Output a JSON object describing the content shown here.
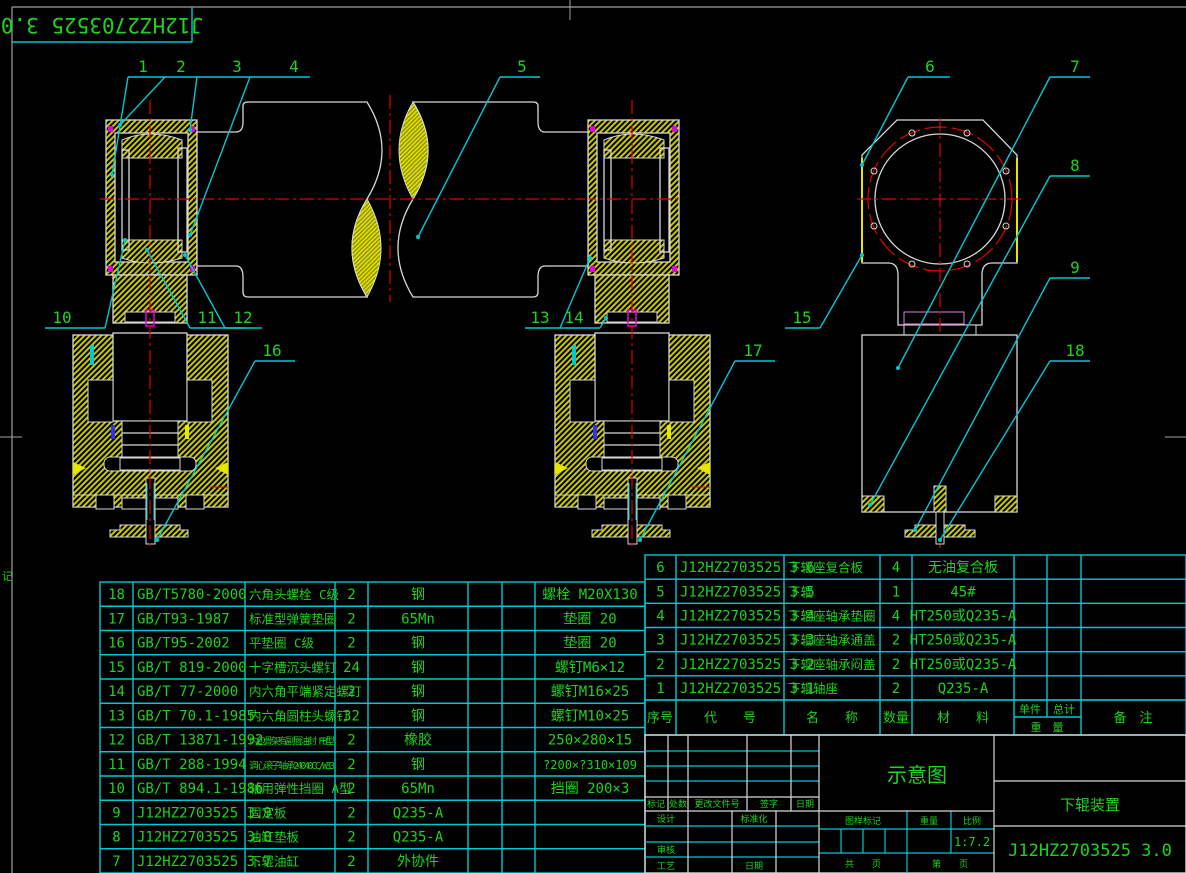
{
  "drawing_number_rotated": "J12HZ2703525 3.0",
  "side_mark": "记",
  "drawing": {
    "balloons": [
      "1",
      "2",
      "3",
      "4",
      "5",
      "6",
      "7",
      "8",
      "9",
      "10",
      "11",
      "12",
      "13",
      "14",
      "15",
      "16",
      "17",
      "18"
    ]
  },
  "parts_list_lower": [
    [
      "18",
      "GB/T5780-2000",
      "六角头螺栓 C级",
      "2",
      "钢",
      "",
      "",
      "螺栓 M20X130"
    ],
    [
      "17",
      "GB/T93-1987",
      "标准型弹簧垫圈",
      "2",
      "65Mn",
      "",
      "",
      "垫圈 20"
    ],
    [
      "16",
      "GB/T95-2002",
      "平垫圈 C级",
      "2",
      "钢",
      "",
      "",
      "垫圈 20"
    ],
    [
      "15",
      "GB/T 819-2000",
      "十字槽沉头螺钉",
      "24",
      "钢",
      "",
      "",
      "螺钉M6×12"
    ],
    [
      "14",
      "GB/T 77-2000",
      "内六角平端紧定螺钉",
      "2",
      "钢",
      "",
      "",
      "螺钉M16×25"
    ],
    [
      "13",
      "GB/T 70.1-1985",
      "内六角圆柱头螺钉",
      "32",
      "钢",
      "",
      "",
      "螺钉M10×25"
    ],
    [
      "12",
      "GB/T 13871-1992",
      "内包骨架有副唇油封 FB型",
      "2",
      "橡胶",
      "",
      "",
      "250×280×15"
    ],
    [
      "11",
      "GB/T 288-1994",
      "调心滚子轴承24040CC/W33",
      "2",
      "钢",
      "",
      "",
      "?200×?310×109"
    ],
    [
      "10",
      "GB/T 894.1-1986",
      "轴用弹性挡圈 A型",
      "2",
      "65Mn",
      "",
      "",
      "挡圈 200×3"
    ],
    [
      "9",
      "J12HZ2703525 3.9",
      "固定板",
      "2",
      "Q235-A",
      "",
      "",
      ""
    ],
    [
      "8",
      "J12HZ2703525 3.8",
      "油缸垫板",
      "2",
      "Q235-A",
      "",
      "",
      ""
    ],
    [
      "7",
      "J12HZ2703525 3.7",
      "下辊油缸",
      "2",
      "外协件",
      "",
      "",
      ""
    ]
  ],
  "parts_list_upper": [
    [
      "6",
      "J12HZ2703525 3.6",
      "下辊座复合板",
      "4",
      "无油复合板",
      "",
      "",
      ""
    ],
    [
      "5",
      "J12HZ2703525 3.5",
      "下辊",
      "1",
      "45#",
      "",
      "",
      ""
    ],
    [
      "4",
      "J12HZ2703525 3.4",
      "下辊座轴承垫圈",
      "4",
      "HT250或Q235-A",
      "",
      "",
      ""
    ],
    [
      "3",
      "J12HZ2703525 3.3",
      "下辊座轴承通盖",
      "2",
      "HT250或Q235-A",
      "",
      "",
      ""
    ],
    [
      "2",
      "J12HZ2703525 3.2",
      "下辊座轴承闷盖",
      "2",
      "HT250或Q235-A",
      "",
      "",
      ""
    ],
    [
      "1",
      "J12HZ2703525 3.1",
      "下辊轴座",
      "2",
      "Q235-A",
      "",
      "",
      ""
    ]
  ],
  "parts_header": {
    "no": "序号",
    "code": "代　　号",
    "name": "名　　称",
    "qty": "数量",
    "material": "材　　料",
    "single": "单件",
    "total": "总计",
    "weight": "重　量",
    "note": "备　注"
  },
  "title_block": {
    "mark": "标记",
    "count": "处数",
    "change_doc": "更改文件号",
    "signature": "签字",
    "date": "日期",
    "design": "设计",
    "standardize": "标准化",
    "review": "审核",
    "process": "工艺",
    "date2": "日期",
    "drawing_type": "示意图",
    "stage_mark": "图样标记",
    "weight": "重量",
    "scale": "比例",
    "scale_value": "1:7.2",
    "total_sheets": "共　　页",
    "sheet_no": "第　　页",
    "assembly_name": "下辊装置",
    "drawing_number": "J12HZ2703525 3.0"
  },
  "colors": {
    "text": "#1ed21e",
    "grid": "#00c8d2",
    "line": "#d8d8d8",
    "center": "#e00000",
    "hatch": "#c8c800"
  }
}
